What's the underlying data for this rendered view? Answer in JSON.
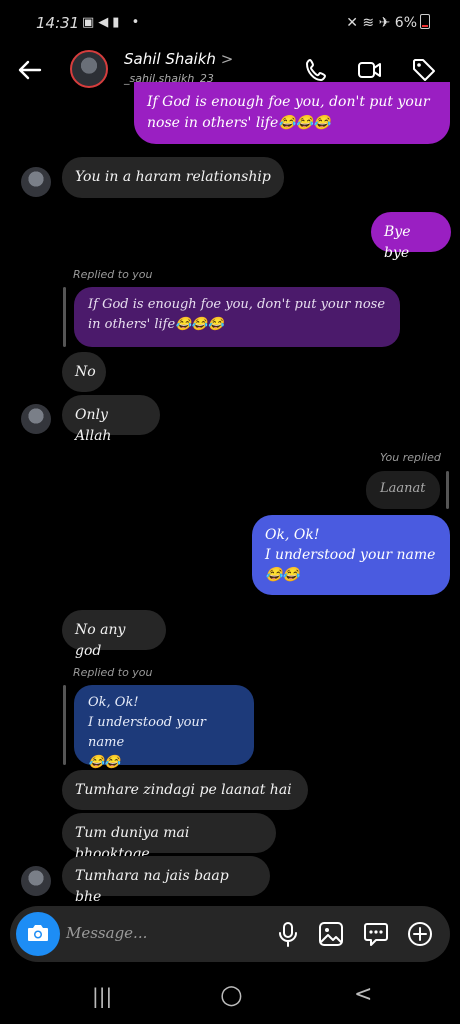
{
  "status": {
    "time": "14:31",
    "left_icons": "▣◀▮ •",
    "battery": "6%"
  },
  "header": {
    "name": "Sahil Shaikh",
    "chevron": ">",
    "username": "_sahil.shaikh_23",
    "icons": [
      "back-arrow-icon",
      "phone-icon",
      "video-icon",
      "tag-icon"
    ]
  },
  "messages": {
    "m0": "If God is enough foe you,  don't put your nose in others' life😂😂😂",
    "m1": "You in a haram relationship",
    "m2": "Bye bye",
    "reply1_label": "Replied to you",
    "reply1_quote": "If God is enough foe you,  don't put your nose in others' life😂😂😂",
    "m3": "No",
    "m4": "Only Allah",
    "reply2_label": "You replied",
    "reply2_quote": "Laanat",
    "m5": "Ok, Ok!\nI understood your name\n😂😂",
    "m6": "No any god",
    "reply3_label": "Replied to you",
    "reply3_quote": "Ok, Ok!\nI understood your name\n😂😂",
    "m7": "Tumhare zindagi pe laanat hai",
    "m8": "Tum duniya mai bhooktoge",
    "m9": "Tumhara na jais baap bhe"
  },
  "composer": {
    "placeholder": "Message...",
    "icons": [
      "camera-icon",
      "mic-icon",
      "gallery-icon",
      "sticker-icon",
      "plus-icon"
    ]
  },
  "nav": {
    "recent": "|||",
    "home": "○",
    "back": "<"
  },
  "colors": {
    "purple": "#9a1fc2",
    "blue": "#4a5be0",
    "incoming": "#262626",
    "camera": "#1d8df5"
  }
}
